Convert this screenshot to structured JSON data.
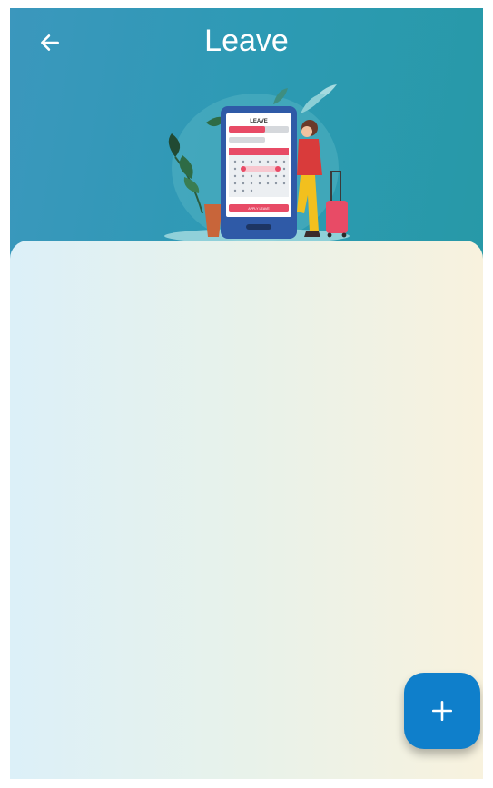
{
  "header": {
    "title": "Leave",
    "back_icon": "arrow-left-icon",
    "background": "#2e98b6"
  },
  "illustration": {
    "screen_heading": "LEAVE",
    "submit_label": "APPLY LEAVE",
    "accent": "#e84b66",
    "phone_color": "#2f5aa7"
  },
  "fab": {
    "icon": "plus-icon",
    "color": "#0f7fcb"
  }
}
